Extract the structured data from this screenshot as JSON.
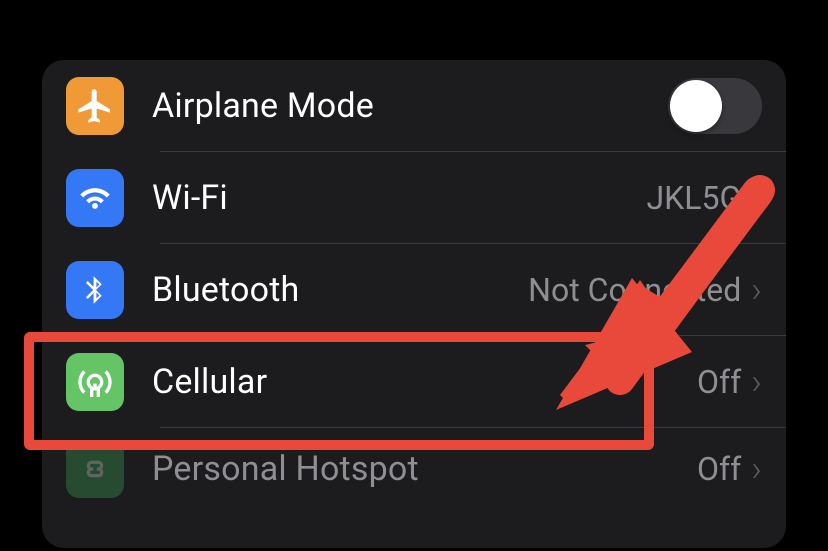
{
  "rows": {
    "airplane": {
      "label": "Airplane Mode",
      "toggle_on": false
    },
    "wifi": {
      "label": "Wi-Fi",
      "detail": "JKL5G"
    },
    "bluetooth": {
      "label": "Bluetooth",
      "detail": "Not Connected"
    },
    "cellular": {
      "label": "Cellular",
      "detail": "Off"
    },
    "hotspot": {
      "label": "Personal Hotspot",
      "detail": "Off"
    }
  },
  "colors": {
    "highlight": "#e8493a",
    "arrow": "#e8493a"
  }
}
